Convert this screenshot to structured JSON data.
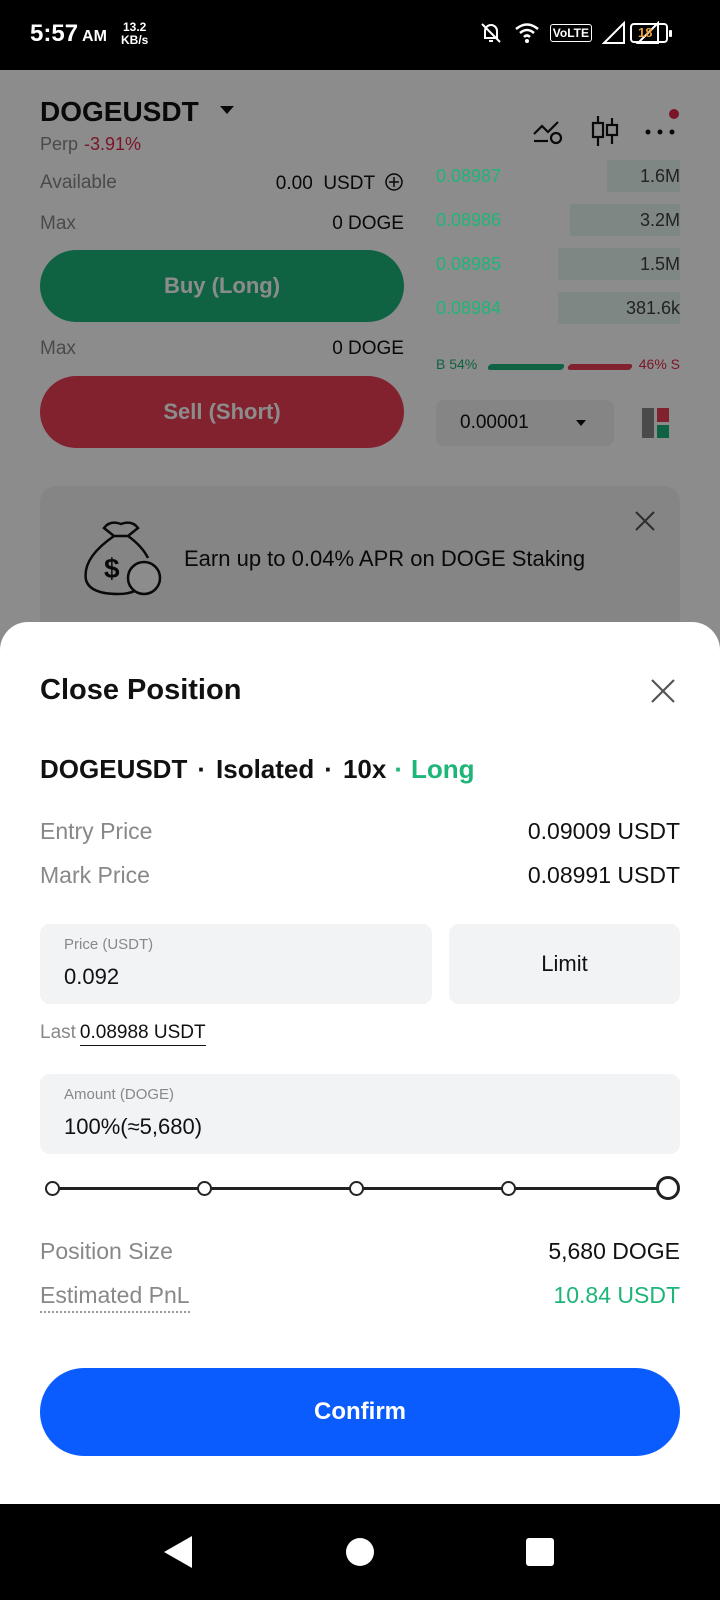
{
  "status_bar": {
    "time": "5:57",
    "ampm": "AM",
    "speed_value": "13.2",
    "speed_unit": "KB/s",
    "network": "VoLTE",
    "battery": "18"
  },
  "header": {
    "pair": "DOGEUSDT",
    "market": "Perp",
    "change": "-3.91%"
  },
  "trade_panel": {
    "available_label": "Available",
    "available_value": "0.00",
    "available_unit": "USDT",
    "max_label": "Max",
    "max_buy_value": "0 DOGE",
    "buy_label": "Buy (Long)",
    "max_sell_value": "0 DOGE",
    "sell_label": "Sell (Short)"
  },
  "order_book": {
    "rows": [
      {
        "price": "0.08987",
        "qty": "1.6M",
        "depth": 0.3
      },
      {
        "price": "0.08986",
        "qty": "3.2M",
        "depth": 0.45
      },
      {
        "price": "0.08985",
        "qty": "1.5M",
        "depth": 0.5
      },
      {
        "price": "0.08984",
        "qty": "381.6k",
        "depth": 0.5
      }
    ],
    "buy_ratio": "B 54%",
    "sell_ratio": "46% S",
    "tick_size": "0.00001"
  },
  "promo": {
    "text": "Earn up to 0.04% APR on DOGE Staking"
  },
  "sheet": {
    "title": "Close Position",
    "pair": "DOGEUSDT",
    "margin_mode": "Isolated",
    "leverage": "10x",
    "side": "Long",
    "entry_price_label": "Entry Price",
    "entry_price_value": "0.09009 USDT",
    "mark_price_label": "Mark Price",
    "mark_price_value": "0.08991 USDT",
    "price_field_label": "Price (USDT)",
    "price_field_value": "0.092",
    "order_type": "Limit",
    "last_label": "Last",
    "last_value": "0.08988 USDT",
    "amount_field_label": "Amount (DOGE)",
    "amount_field_value": "100%(≈5,680)",
    "slider_percent": 100,
    "position_size_label": "Position Size",
    "position_size_value": "5,680 DOGE",
    "pnl_label": "Estimated PnL",
    "pnl_value": "10.84 USDT",
    "confirm_label": "Confirm"
  },
  "colors": {
    "buy": "#1eb578",
    "sell": "#ee3e56",
    "primary": "#0a5cff"
  }
}
